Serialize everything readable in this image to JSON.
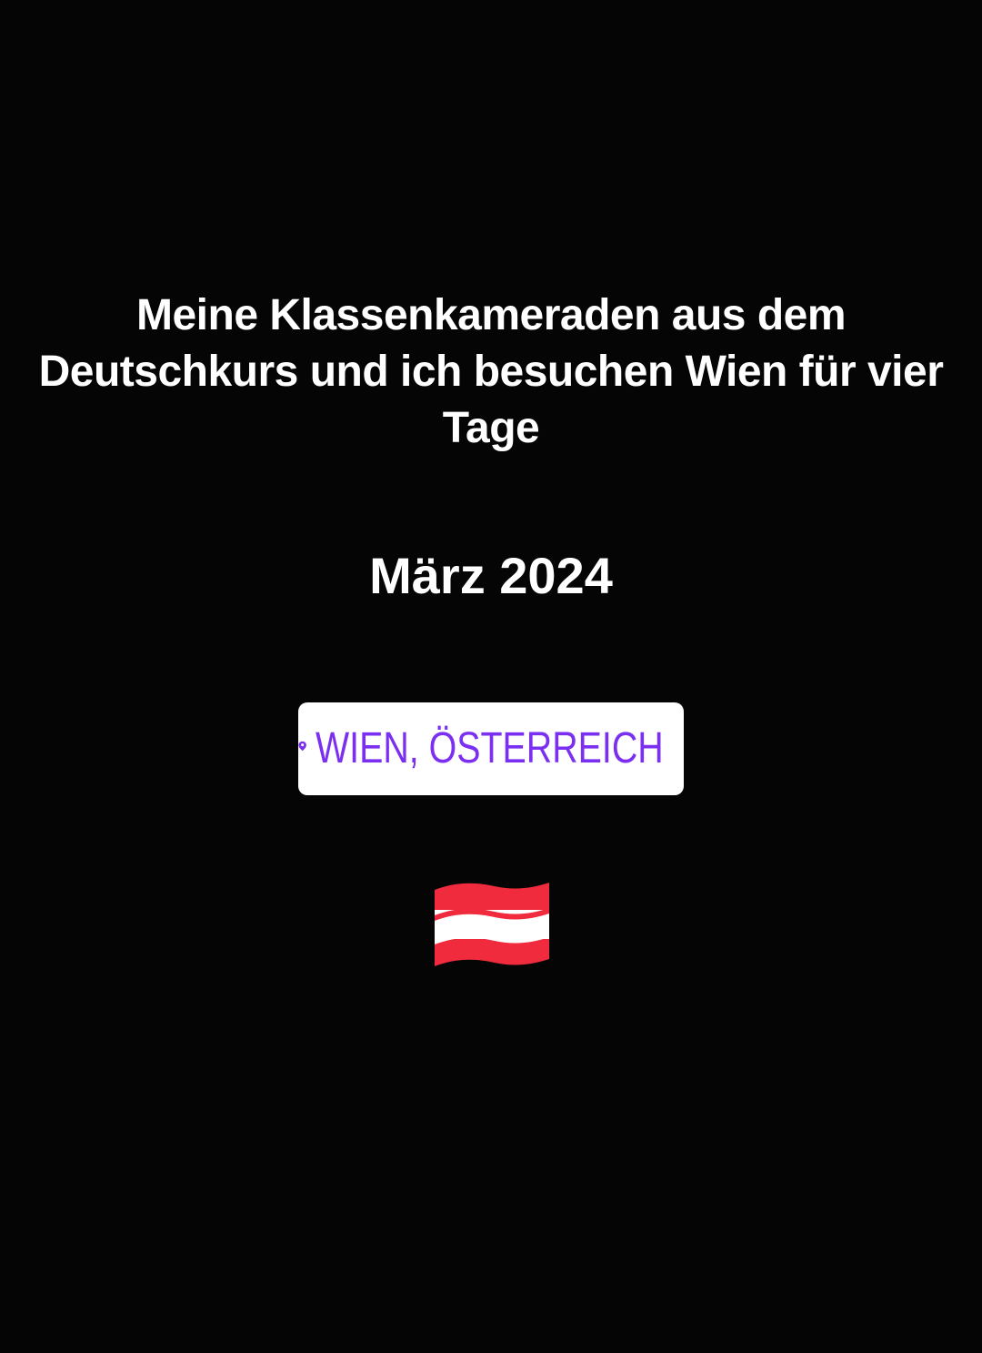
{
  "story": {
    "caption": "Meine Klassenkameraden aus dem Deutschkurs und ich besuchen Wien für vier Tage",
    "date": "März 2024",
    "location_sticker": {
      "label": "WIEN, ÖSTERREICH",
      "icon": "location-pin-icon",
      "text_color": "#7b2ff0",
      "background": "#ffffff"
    },
    "flag": {
      "icon": "austria-flag-icon",
      "colors": [
        "#ef2b3d",
        "#ffffff",
        "#ef2b3d"
      ]
    },
    "background": "#000000"
  }
}
